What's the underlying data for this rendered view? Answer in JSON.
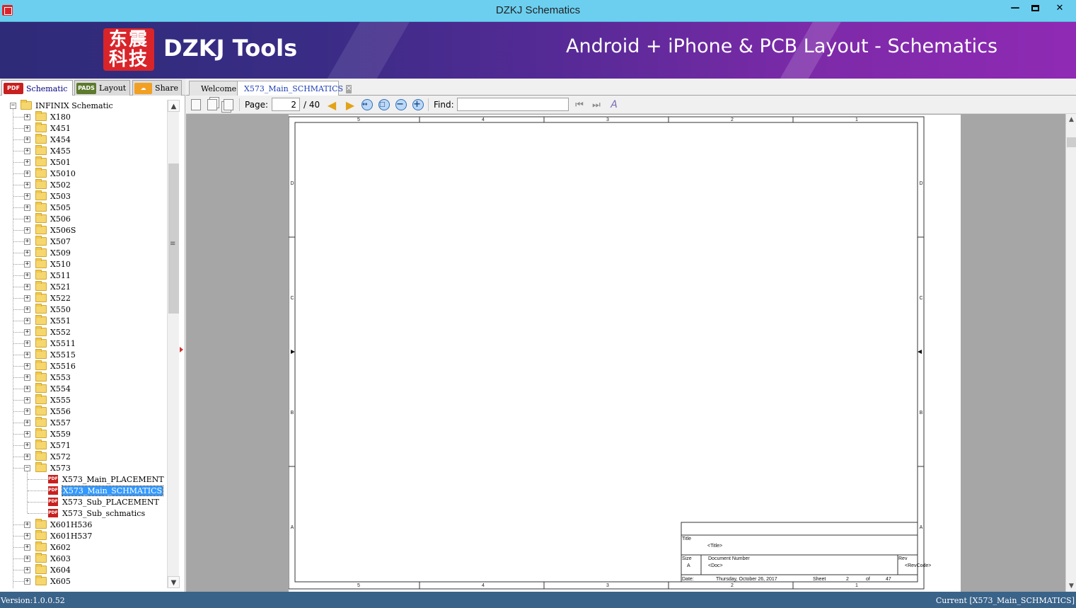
{
  "window": {
    "title": "DZKJ Schematics",
    "minimize_icon": "minimize-icon",
    "maximize_icon": "maximize-icon",
    "close_icon": "close-icon"
  },
  "banner": {
    "logo_text": "东震科技",
    "brand": "DZKJ Tools",
    "tagline": "Android + iPhone & PCB Layout - Schematics"
  },
  "left_tabs": [
    {
      "icon": "PDF",
      "label": "Schematic",
      "active": true
    },
    {
      "icon": "PADS",
      "label": "Layout",
      "active": false
    },
    {
      "icon": "share-cloud-icon",
      "label": "Share",
      "active": false
    }
  ],
  "tree": {
    "root": "INFINIX Schematic",
    "folders_before": [
      "X180",
      "X451",
      "X454",
      "X455",
      "X501",
      "X5010",
      "X502",
      "X503",
      "X505",
      "X506",
      "X506S",
      "X507",
      "X509",
      "X510",
      "X511",
      "X521",
      "X522",
      "X550",
      "X551",
      "X552",
      "X5511",
      "X5515",
      "X5516",
      "X553",
      "X554",
      "X555",
      "X556",
      "X557",
      "X559",
      "X571",
      "X572"
    ],
    "expanded_folder": "X573",
    "files": [
      "X573_Main_PLACEMENT",
      "X573_Main_SCHMATICS",
      "X573_Sub_PLACEMENT",
      "X573_Sub_schmatics"
    ],
    "selected_file": "X573_Main_SCHMATICS",
    "folders_after": [
      "X601H536",
      "X601H537",
      "X602",
      "X603",
      "X604",
      "X605"
    ]
  },
  "doc_tabs": [
    {
      "label": "Welcome",
      "active": false
    },
    {
      "label": "X573_Main_SCHMATICS",
      "active": true,
      "close": "✕"
    }
  ],
  "toolbar": {
    "page_label": "Page:",
    "page_value": "2",
    "page_total": "/ 40",
    "find_label": "Find:",
    "find_value": ""
  },
  "sheet": {
    "col_labels": [
      "5",
      "4",
      "3",
      "2",
      "1"
    ],
    "row_labels": [
      "D",
      "C",
      "B",
      "A"
    ],
    "title_block": {
      "title_label": "Title",
      "title_value": "<Title>",
      "size_label": "Size",
      "size_value": "A",
      "docnum_label": "Document  Number",
      "docnum_value": "<Doc>",
      "rev_label": "Rev",
      "rev_value": "<RevCode>",
      "date_label": "Date:",
      "date_value": "Thursday, October 26, 2017",
      "sheet_label": "Sheet",
      "sheet_num": "2",
      "of_label": "of",
      "sheet_total": "47"
    }
  },
  "status": {
    "version": "Version:1.0.0.52",
    "current": "Current [X573_Main_SCHMATICS]"
  }
}
